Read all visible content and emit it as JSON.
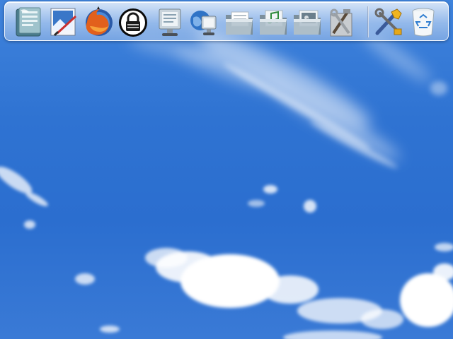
{
  "desktop": {
    "wallpaper": "blue-sky-clouds",
    "colors": {
      "sky_top": "#3f83dc",
      "sky_bottom": "#2b6ecf",
      "dock_tint": "#dce8f8"
    }
  },
  "dock": {
    "launchers": [
      {
        "name": "office-writer",
        "icon": "office-document-icon"
      },
      {
        "name": "image-editor",
        "icon": "paint-brush-canvas-icon"
      },
      {
        "name": "firefox",
        "icon": "firefox-globe-icon"
      },
      {
        "name": "lock-screen",
        "icon": "padlock-icon"
      },
      {
        "name": "my-computer",
        "icon": "computer-monitor-icon"
      },
      {
        "name": "network",
        "icon": "network-globe-icon"
      },
      {
        "name": "documents-folder",
        "icon": "folder-documents-icon"
      },
      {
        "name": "music-folder",
        "icon": "folder-music-icon"
      },
      {
        "name": "pictures-folder",
        "icon": "folder-pictures-icon"
      },
      {
        "name": "system-tools",
        "icon": "tools-hammer-wrench-icon"
      },
      {
        "name": "settings",
        "icon": "settings-tools-icon"
      },
      {
        "name": "trash",
        "icon": "recycle-bin-icon"
      }
    ]
  }
}
